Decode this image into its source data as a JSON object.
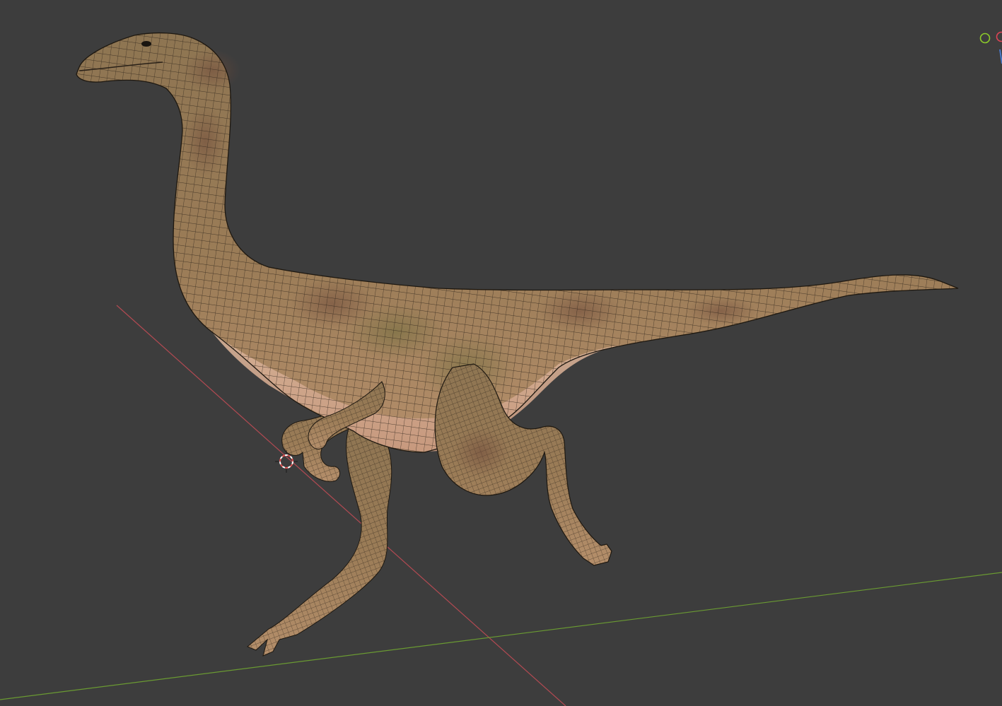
{
  "viewport": {
    "background": "#3d3d3d"
  },
  "axes": {
    "x_axis_color": "#b24a52",
    "y_axis_color": "#6a9a32"
  },
  "model": {
    "subject": "dinosaur-mesh",
    "wireframe": true,
    "skin_color": "#9a7a55",
    "belly_color": "#d9ad8e",
    "wire_color": "#2a2118"
  },
  "gizmo": {
    "icons": [
      "navigation-gizmo-y-icon",
      "navigation-gizmo-x-icon"
    ],
    "y_color": "#8ccb2a",
    "x_color": "#e04455"
  },
  "cursor": {
    "icon": "3d-cursor-icon",
    "ring_color_a": "#e05050",
    "ring_color_b": "#ffffff"
  }
}
